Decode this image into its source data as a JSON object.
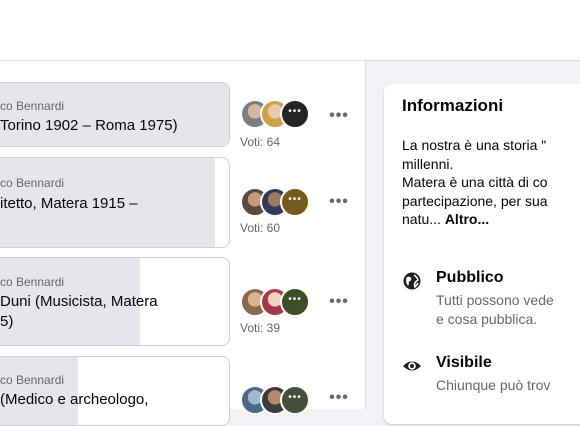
{
  "poll": {
    "options": [
      {
        "author": "co Bennardi",
        "text_lines": [
          "Torino 1902 – Roma 1975)"
        ],
        "votes_label": "Voti: 64",
        "vote_share_pct": 100
      },
      {
        "author": "co Bennardi",
        "text_lines": [
          "itetto, Matera 1915 –",
          ""
        ],
        "votes_label": "Voti: 60",
        "vote_share_pct": 94
      },
      {
        "author": "co Bennardi",
        "text_lines": [
          "Duni (Musicista, Matera",
          "5)"
        ],
        "votes_label": "Voti: 39",
        "vote_share_pct": 61
      },
      {
        "author": "co Bennardi",
        "text_lines": [
          "(Medico e archeologo,",
          ""
        ],
        "votes_label": "",
        "vote_share_pct": 34
      }
    ],
    "more_indicator": "•••",
    "options_button_label": "•••"
  },
  "info": {
    "title": "Informazioni",
    "description_lines": [
      "La nostra è una storia \"",
      "millenni.",
      "Matera è una città di co",
      "partecipazione, per sua",
      "natu... "
    ],
    "more_link": "Altro...",
    "privacy": {
      "title": "Pubblico",
      "lines": [
        "Tutti possono vede",
        "e cosa pubblica."
      ],
      "icon": "globe-icon"
    },
    "visibility": {
      "title": "Visibile",
      "lines": [
        "Chiunque può trov"
      ],
      "icon": "eye-icon"
    }
  },
  "colors": {
    "fill": "#e4e6eb",
    "muted_text": "#65676b",
    "border": "#ced0d4"
  }
}
